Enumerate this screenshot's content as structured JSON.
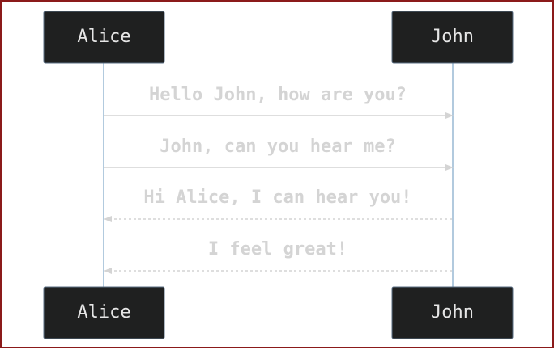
{
  "diagram": {
    "type": "sequence",
    "actors": [
      {
        "id": "alice",
        "label": "Alice"
      },
      {
        "id": "john",
        "label": "John"
      }
    ],
    "messages": [
      {
        "from": "alice",
        "to": "john",
        "text": "Hello John, how are you?",
        "style": "solid"
      },
      {
        "from": "alice",
        "to": "john",
        "text": "John, can you hear me?",
        "style": "solid"
      },
      {
        "from": "john",
        "to": "alice",
        "text": "Hi Alice, I can hear you!",
        "style": "dotted"
      },
      {
        "from": "john",
        "to": "alice",
        "text": "I feel great!",
        "style": "dotted"
      }
    ],
    "colors": {
      "actor_fill": "#1f2020",
      "actor_text": "#e6e6e6",
      "lifeline": "#7fa6c9",
      "message": "#d4d4d4",
      "frame_border": "#8b1a1a"
    }
  }
}
